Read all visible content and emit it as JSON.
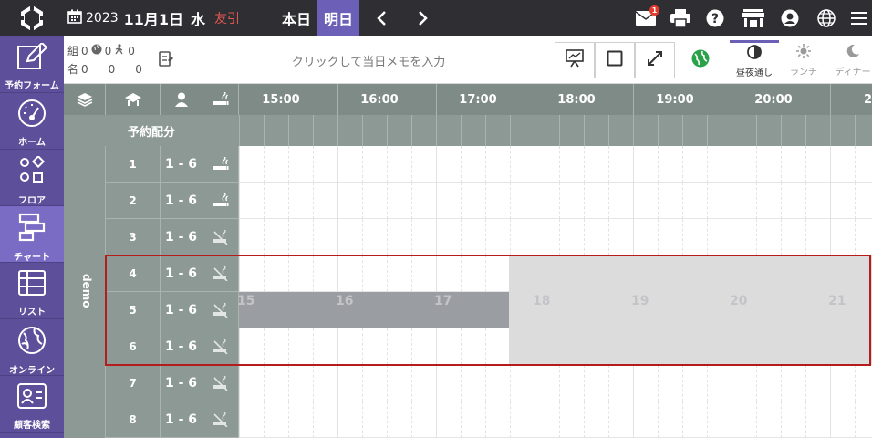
{
  "topbar": {
    "year": "2023",
    "month_day": "11月1日",
    "weekday": "水",
    "rokuyo": "友引",
    "today_label": "本日",
    "tomorrow_label": "明日",
    "mail_badge": "1",
    "icons": [
      "logo-icon",
      "calendar-icon",
      "prev-icon",
      "next-icon",
      "mail-icon",
      "print-icon",
      "help-icon",
      "store-icon",
      "account-icon",
      "language-icon",
      "menu-icon"
    ]
  },
  "sidebar": {
    "items": [
      {
        "label": "予約フォーム",
        "icon": "edit-icon"
      },
      {
        "label": "ホーム",
        "icon": "dashboard-icon"
      },
      {
        "label": "フロア",
        "icon": "floor-icon"
      },
      {
        "label": "チャート",
        "icon": "chart-icon"
      },
      {
        "label": "リスト",
        "icon": "list-icon"
      },
      {
        "label": "オンライン",
        "icon": "globe-icon"
      },
      {
        "label": "顧客検索",
        "icon": "customer-icon"
      }
    ],
    "active": "チャート"
  },
  "toolbar": {
    "counts": {
      "row1_label": "組",
      "row1": [
        "0",
        "0",
        "0"
      ],
      "row2_label": "名",
      "row2": [
        "0",
        "0",
        "0"
      ]
    },
    "memo_placeholder": "クリックして当日メモを入力",
    "modes": [
      {
        "label": "昼夜通し",
        "active": true
      },
      {
        "label": "ランチ",
        "active": false
      },
      {
        "label": "ディナー",
        "active": false
      }
    ]
  },
  "grid": {
    "allocation_label": "予約配分",
    "group_label": "demo",
    "times": [
      "15:00",
      "16:00",
      "17:00",
      "18:00",
      "19:00",
      "20:00",
      "21"
    ],
    "tables": [
      {
        "no": "1",
        "cap": "1 - 6",
        "smoking": true
      },
      {
        "no": "2",
        "cap": "1 - 6",
        "smoking": true
      },
      {
        "no": "3",
        "cap": "1 - 6",
        "smoking": false
      },
      {
        "no": "4",
        "cap": "1 - 6",
        "smoking": false
      },
      {
        "no": "5",
        "cap": "1 - 6",
        "smoking": false
      },
      {
        "no": "6",
        "cap": "1 - 6",
        "smoking": false
      },
      {
        "no": "7",
        "cap": "1 - 6",
        "smoking": false
      },
      {
        "no": "8",
        "cap": "1 - 6",
        "smoking": false
      }
    ],
    "overlay_hours": [
      "15",
      "16",
      "17",
      "18",
      "19",
      "20",
      "21"
    ]
  }
}
